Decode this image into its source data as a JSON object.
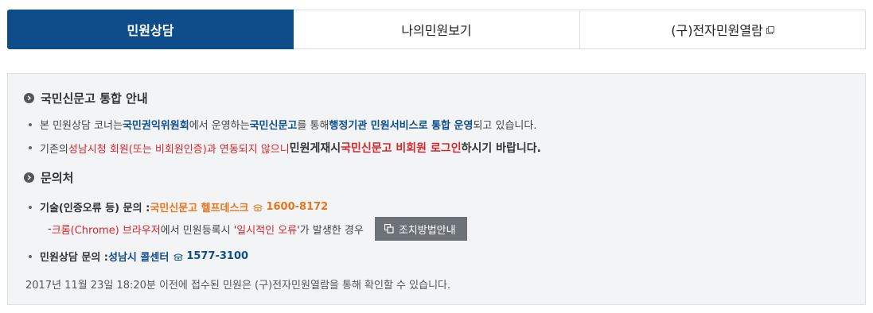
{
  "tabs": [
    {
      "label": "민원상담"
    },
    {
      "label": "나의민원보기"
    },
    {
      "label": "(구)전자민원열람"
    }
  ],
  "notice": {
    "title": "국민신문고 통합 안내",
    "line1": {
      "a": "본 민원상담 코너는 ",
      "b": "국민권익위원회",
      "c": "에서 운영하는 ",
      "d": "국민신문고",
      "e": "를 통해 ",
      "f": "행정기관 민원서비스로 통합 운영",
      "g": "되고 있습니다."
    },
    "line2": {
      "a": "기존의 ",
      "b": "성남시청 회원(또는 비회원인증)",
      "c": "과 연동되지 않으니 ",
      "d": "민원게재시 ",
      "e": "국민신문고 비회원 로그인",
      "f": "하시기 바랍니다."
    }
  },
  "contact": {
    "title": "문의처",
    "tech": {
      "label": "기술(인증오류 등) 문의 : ",
      "desk": "국민신문고 헬프데스크",
      "phone": "1600-8172"
    },
    "chrome": {
      "a": "- ",
      "b": "크롬(Chrome) 브라우저",
      "c": "에서 민원등록시 '",
      "d": "일시적인 오류",
      "e": "'가 발생한 경우",
      "button": "조치방법안내"
    },
    "consult": {
      "label": "민원상담 문의 : ",
      "center": "성남시 콜센터",
      "phone": "1577-3100"
    }
  },
  "footnote": "2017년 11월 23일 18:20분 이전에 접수된 민원은 (구)전자민원열람을 통해 확인할 수 있습니다.",
  "colors": {
    "primary": "#0f4c8a",
    "accent_red": "#d9262b",
    "accent_orange": "#e8751a",
    "button_gray": "#6d7278"
  }
}
